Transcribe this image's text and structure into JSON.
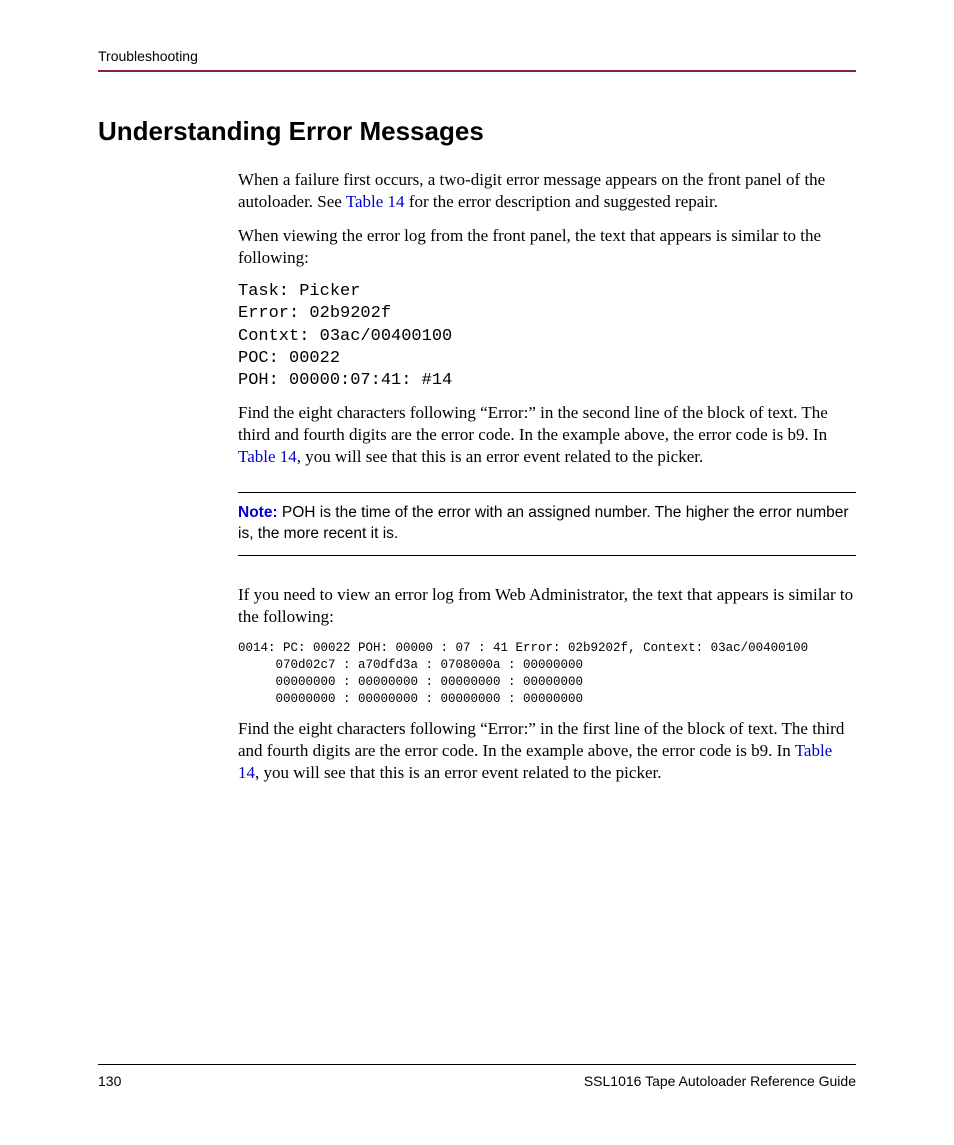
{
  "header": {
    "running": "Troubleshooting"
  },
  "section": {
    "title": "Understanding Error Messages"
  },
  "p1": {
    "t1": "When a failure first occurs, a two-digit error message appears on the front panel of the autoloader. See ",
    "link": "Table 14",
    "t2": " for the error description and suggested repair."
  },
  "p2": "When viewing the error log from the front panel, the text that appears is similar to the following:",
  "code1": "Task: Picker\nError: 02b9202f\nContxt: 03ac/00400100\nPOC: 00022\nPOH: 00000:07:41: #14",
  "p3": {
    "t1": "Find the eight characters following “Error:” in the second line of the block of text. The third and fourth digits are the error code. In the example above, the error code is b9. In ",
    "link": "Table 14",
    "t2": ", you will see that this is an error event related to the picker."
  },
  "note": {
    "label": "Note:",
    "text": "  POH is the time of the error with an assigned number. The higher the error number is, the more recent it is."
  },
  "p4": "If you need to view an error log from Web Administrator, the text that appears is similar to the following:",
  "code2": "0014: PC: 00022 POH: 00000 : 07 : 41 Error: 02b9202f, Context: 03ac/00400100\n     070d02c7 : a70dfd3a : 0708000a : 00000000\n     00000000 : 00000000 : 00000000 : 00000000\n     00000000 : 00000000 : 00000000 : 00000000",
  "p5": {
    "t1": "Find the eight characters following “Error:” in the first line of the block of text. The third and fourth digits are the error code. In the example above, the error code is b9. In ",
    "link": "Table 14",
    "t2": ", you will see that this is an error event related to the picker."
  },
  "footer": {
    "page": "130",
    "doc": "SSL1016 Tape Autoloader Reference Guide"
  }
}
